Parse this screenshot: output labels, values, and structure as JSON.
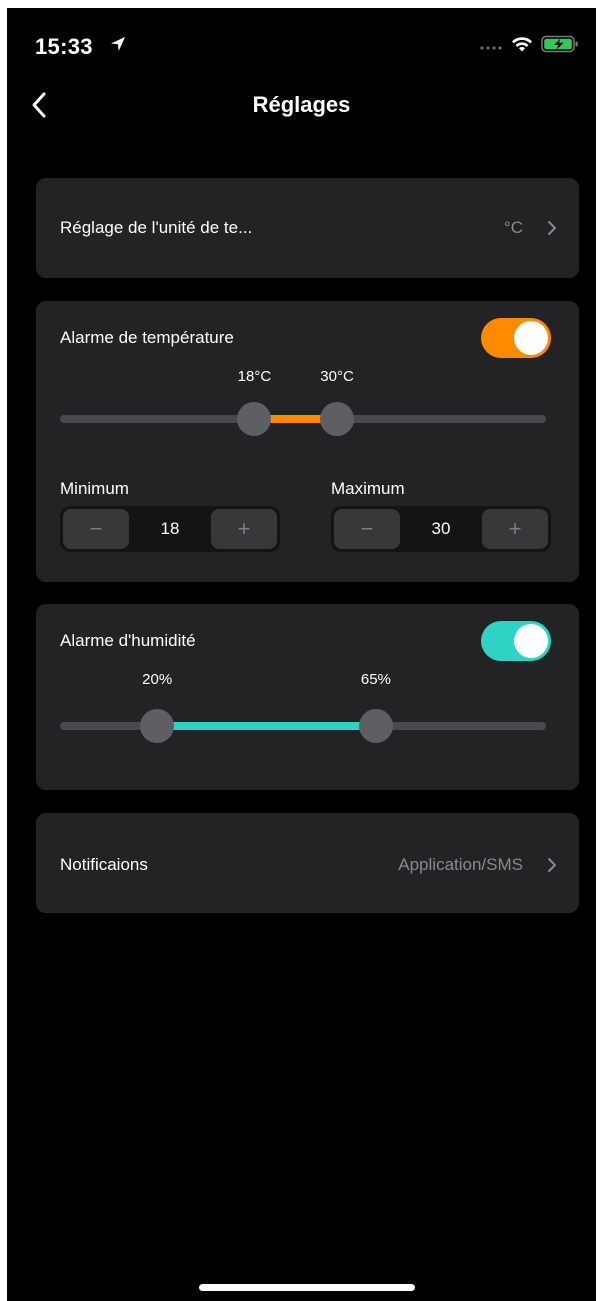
{
  "status_bar": {
    "time": "15:33",
    "icons": [
      "location-arrow-icon",
      "signal-icon",
      "wifi-icon",
      "battery-charging-icon"
    ]
  },
  "nav": {
    "title": "Réglages",
    "back_icon": "chevron-left-icon"
  },
  "unit_row": {
    "label": "Réglage de l'unité de te...",
    "value": "°C"
  },
  "temperature_alarm": {
    "label": "Alarme de température",
    "enabled": true,
    "toggle_color": "#ff8a00",
    "range_color": "#ff8a00",
    "slider_min_fraction": 0.4,
    "slider_max_fraction": 0.57,
    "min_label": "18°C",
    "max_label": "30°C",
    "minimum": {
      "title": "Minimum",
      "value": "18",
      "minus": "−",
      "plus": "+"
    },
    "maximum": {
      "title": "Maximum",
      "value": "30",
      "minus": "−",
      "plus": "+"
    }
  },
  "humidity_alarm": {
    "label": "Alarme d'humidité",
    "enabled": true,
    "toggle_color": "#2ed3c6",
    "range_color": "#2ed3c6",
    "slider_min_fraction": 0.2,
    "slider_max_fraction": 0.65,
    "min_label": "20%",
    "max_label": "65%"
  },
  "notifications_row": {
    "label": "Notificaions",
    "value": "Application/SMS"
  },
  "colors": {
    "background": "#000000",
    "card": "#232325",
    "secondary_text": "#8a8a8e"
  }
}
